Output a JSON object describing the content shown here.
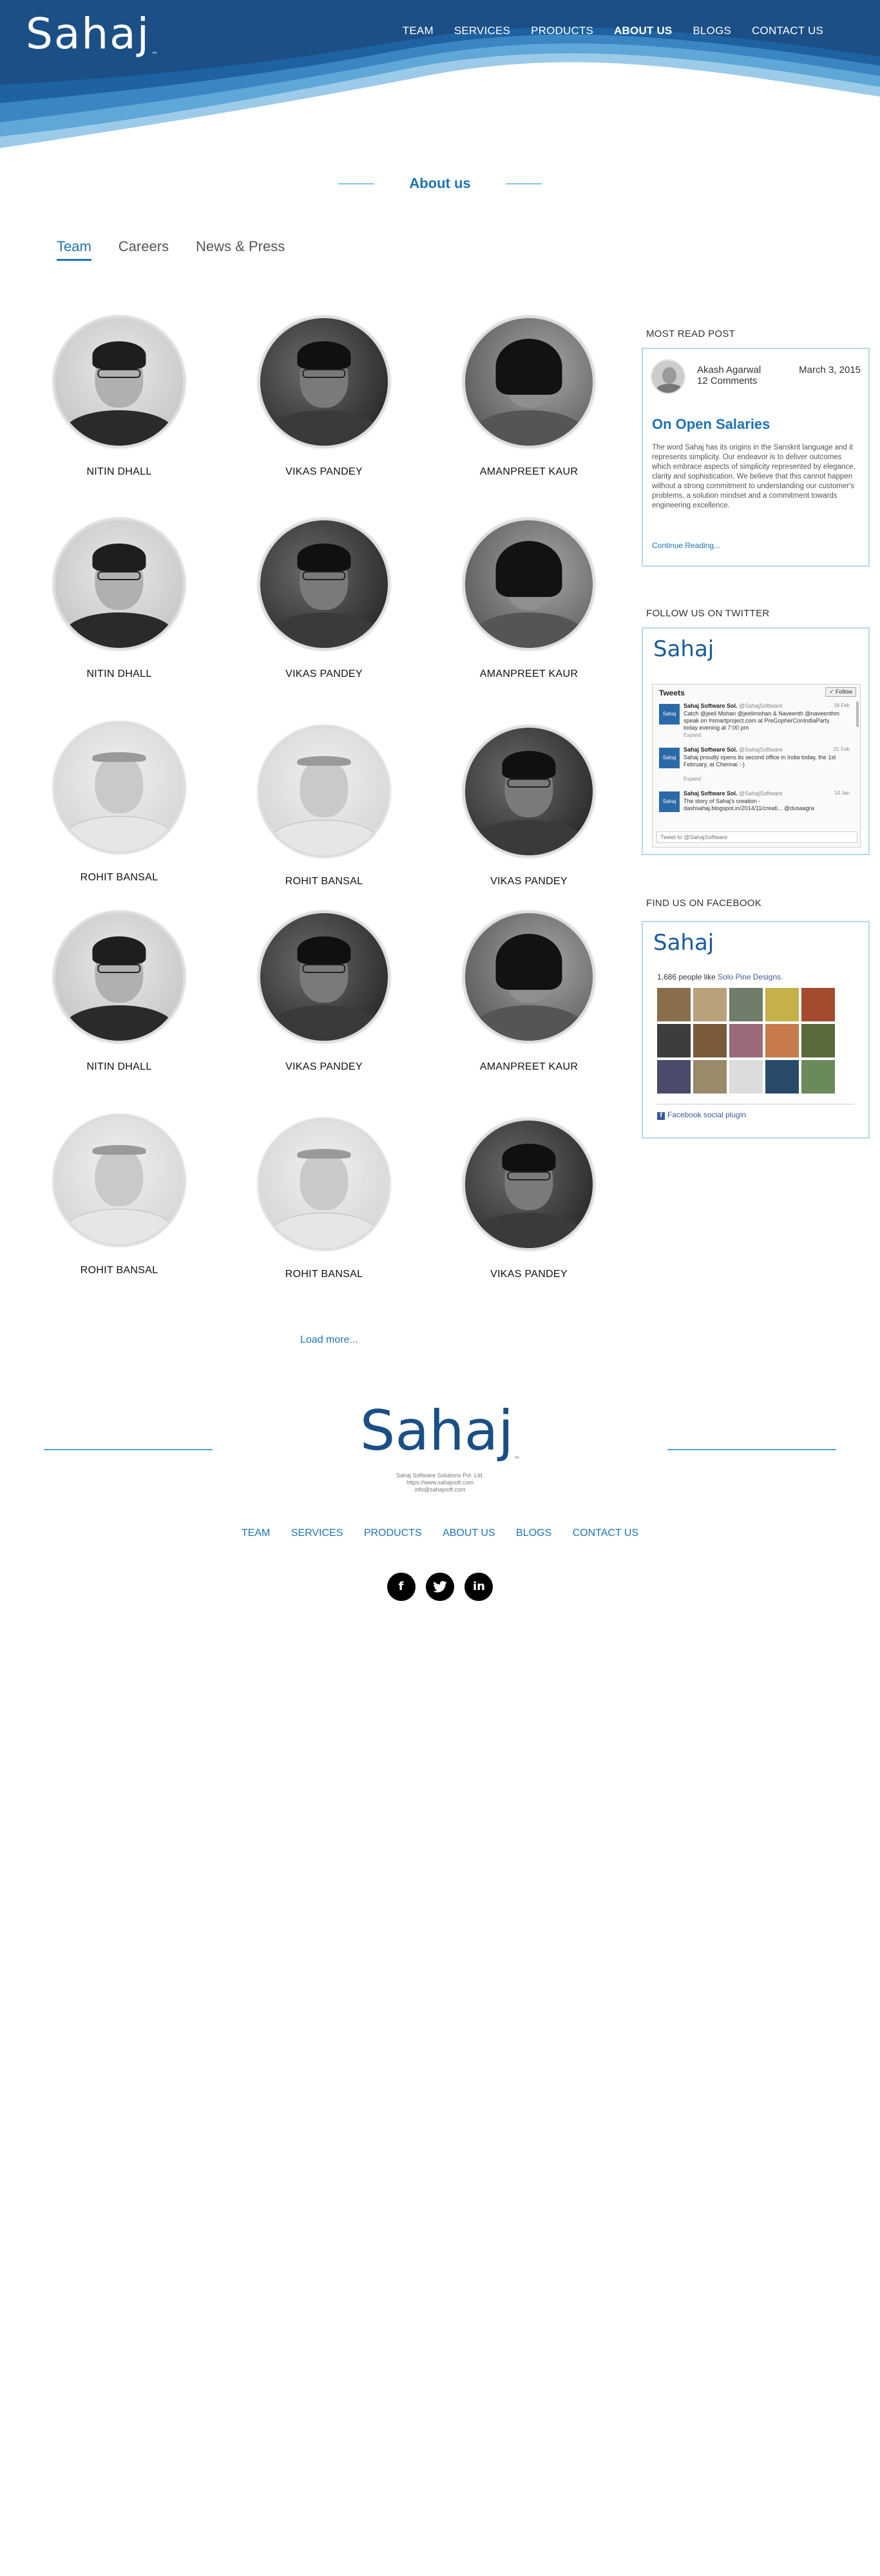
{
  "brand": {
    "logo": "Sahaj",
    "tm": "™"
  },
  "nav": {
    "items": [
      {
        "label": "TEAM"
      },
      {
        "label": "SERVICES"
      },
      {
        "label": "PRODUCTS"
      },
      {
        "label": "ABOUT US",
        "active": true
      },
      {
        "label": "BLOGS"
      },
      {
        "label": "CONTACT US"
      }
    ]
  },
  "section": {
    "title": "About us"
  },
  "tabs": [
    {
      "label": "Team",
      "active": true
    },
    {
      "label": "Careers"
    },
    {
      "label": "News & Press"
    }
  ],
  "team": [
    {
      "name": "NITIN DHALL"
    },
    {
      "name": "VIKAS PANDEY"
    },
    {
      "name": "AMANPREET KAUR"
    },
    {
      "name": "NITIN DHALL"
    },
    {
      "name": "VIKAS PANDEY"
    },
    {
      "name": "AMANPREET KAUR"
    },
    {
      "name": "ROHIT BANSAL"
    },
    {
      "name": "ROHIT BANSAL"
    },
    {
      "name": "VIKAS PANDEY"
    },
    {
      "name": "NITIN DHALL"
    },
    {
      "name": "VIKAS PANDEY"
    },
    {
      "name": "AMANPREET KAUR"
    },
    {
      "name": "ROHIT BANSAL"
    },
    {
      "name": "ROHIT BANSAL"
    },
    {
      "name": "VIKAS PANDEY"
    }
  ],
  "load_more": "Load more...",
  "sidebar": {
    "most_read": {
      "heading": "MOST READ POST",
      "author": "Akash Agarwal",
      "comments": "12 Comments",
      "date": "March 3, 2015",
      "title": "On Open Salaries",
      "body": "The word Sahaj has its origins in the Sanskrit language and it represents simplicity. Our endeavor is to deliver outcomes which embrace aspects of simplicity represented by elegance, clarity and sophistication. We believe that this cannot happen without a strong commitment to understanding our customer's problems, a solution mindset and a commitment towards engineering excellence.",
      "more": "Continue Reading..."
    },
    "twitter": {
      "heading": "FOLLOW US ON TWITTER",
      "logo": "Sahaj",
      "tweets_label": "Tweets",
      "follow": "Follow",
      "tweets": [
        {
          "who": "Sahaj Software Sol.",
          "handle": "@SahajSoftware",
          "when": "18 Feb",
          "text": "Catch @jeeli Mohan @jeelimohan & Naveenth @naveenthm speak on #smartproject.com at PreGopherConIndiaParty today evening at 7:00 pm",
          "expand": "Expand"
        },
        {
          "who": "Sahaj Software Sol.",
          "handle": "@SahajSoftware",
          "when": "01 Feb",
          "text": "Sahaj proudly opens its second office in India today, the 1st February, at Chennai :-)",
          "expand": "Expand"
        },
        {
          "who": "Sahaj Software Sol.",
          "handle": "@SahajSoftware",
          "when": "14 Jan",
          "text": "The story of Sahaj's creation - dashsahaj.blogspot.in/2014/11/creati... @dusaagra",
          "expand": ""
        }
      ],
      "input_placeholder": "Tweet to @SahajSoftware"
    },
    "facebook": {
      "heading": "FIND US ON FACEBOOK",
      "logo": "Sahaj",
      "likes_prefix": "1,686 people like",
      "likes_page": "Solo Pine Designs.",
      "plugin": "Facebook social plugin"
    }
  },
  "footer": {
    "logo": "Sahaj",
    "tm": "™",
    "info": [
      "Sahaj Software Solutions Pvt. Ltd.",
      "https://www.sahajsoft.com",
      "info@sahajsoft.com"
    ],
    "nav": [
      "TEAM",
      "SERVICES",
      "PRODUCTS",
      "ABOUT US",
      "BLOGS",
      "CONTACT US"
    ],
    "social": [
      {
        "icon": "facebook-icon",
        "glyph": "f"
      },
      {
        "icon": "twitter-icon",
        "glyph": "t"
      },
      {
        "icon": "linkedin-icon",
        "glyph": "in"
      }
    ]
  },
  "colors": {
    "brand_dark": "#1b4f86",
    "accent": "#1e73b4",
    "wave_light": "#7fbde3"
  }
}
